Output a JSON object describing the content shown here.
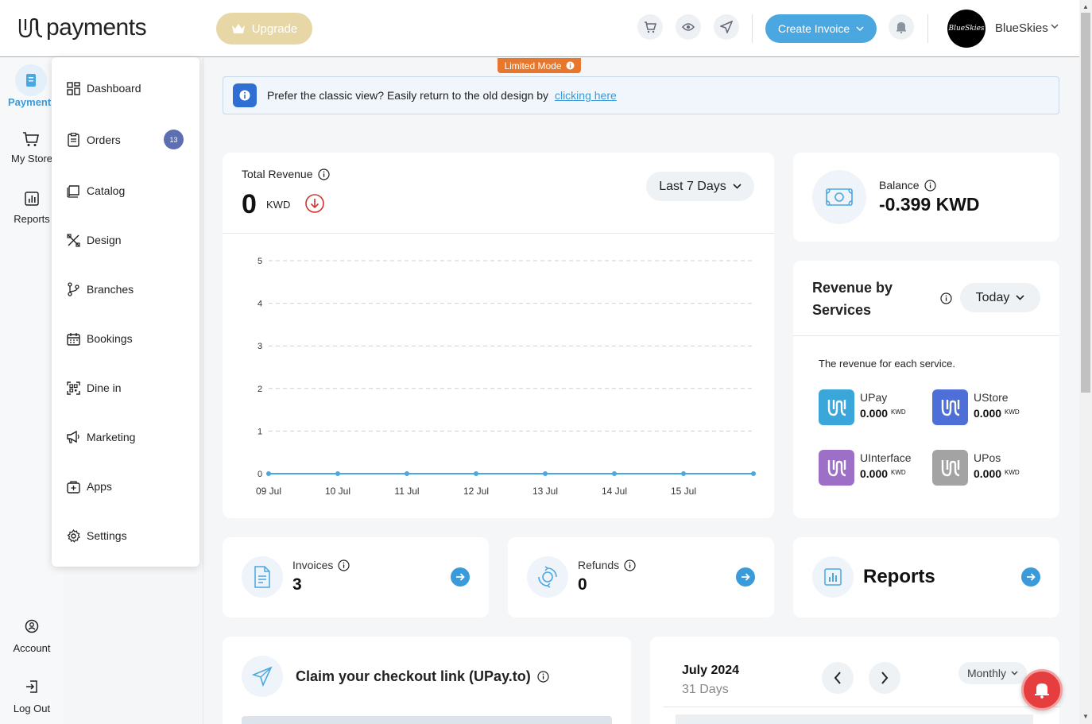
{
  "header": {
    "logo_text": "payments",
    "upgrade_label": "Upgrade",
    "create_invoice_label": "Create Invoice",
    "avatar_text": "BlueSkies",
    "username": "BlueSkies",
    "icons": [
      "cart-icon",
      "eye-icon",
      "send-icon",
      "bell-icon"
    ]
  },
  "rail": {
    "items": [
      {
        "label": "Payments",
        "icon": "payments-icon",
        "active": true
      },
      {
        "label": "My Store",
        "icon": "cart-icon"
      },
      {
        "label": "Reports",
        "icon": "chart-icon"
      },
      {
        "label": "Account",
        "icon": "account-icon"
      },
      {
        "label": "Log Out",
        "icon": "logout-icon"
      }
    ]
  },
  "menu": {
    "items": [
      {
        "label": "Dashboard",
        "icon": "dashboard-icon"
      },
      {
        "label": "Orders",
        "icon": "orders-icon",
        "badge": "13"
      },
      {
        "label": "Catalog",
        "icon": "catalog-icon"
      },
      {
        "label": "Design",
        "icon": "design-icon"
      },
      {
        "label": "Branches",
        "icon": "branches-icon"
      },
      {
        "label": "Bookings",
        "icon": "calendar-icon"
      },
      {
        "label": "Dine in",
        "icon": "qr-icon"
      },
      {
        "label": "Marketing",
        "icon": "megaphone-icon"
      },
      {
        "label": "Apps",
        "icon": "apps-icon"
      },
      {
        "label": "Settings",
        "icon": "gear-icon"
      }
    ]
  },
  "limited_mode": "Limited Mode",
  "banner": {
    "text": "Prefer the classic view? Easily return to the old design by",
    "link": "clicking here"
  },
  "revenue": {
    "title": "Total Revenue",
    "value": "0",
    "unit": "KWD",
    "period": "Last 7 Days"
  },
  "chart_data": {
    "type": "line",
    "categories": [
      "09 Jul",
      "10 Jul",
      "11 Jul",
      "12 Jul",
      "13 Jul",
      "14 Jul",
      "15 Jul",
      ""
    ],
    "series": [
      {
        "values": [
          0,
          0,
          0,
          0,
          0,
          0,
          0,
          0
        ],
        "color": "#4aa7e0"
      }
    ],
    "yticks": [
      "0",
      "1",
      "2",
      "3",
      "4",
      "5"
    ],
    "ylim": [
      0,
      5
    ],
    "grid": true
  },
  "balance": {
    "label": "Balance",
    "value": "-0.399 KWD"
  },
  "services": {
    "title": "Revenue by Services",
    "period": "Today",
    "description": "The revenue for each service.",
    "items": [
      {
        "name": "UPay",
        "amount": "0.000",
        "currency": "KWD",
        "color": "#3aa6da"
      },
      {
        "name": "UStore",
        "amount": "0.000",
        "currency": "KWD",
        "color": "#4f6fd8"
      },
      {
        "name": "UInterface",
        "amount": "0.000",
        "currency": "KWD",
        "color": "#9d6fc7"
      },
      {
        "name": "UPos",
        "amount": "0.000",
        "currency": "KWD",
        "color": "#a3a3a3"
      }
    ]
  },
  "invoices": {
    "label": "Invoices",
    "value": "3"
  },
  "refunds": {
    "label": "Refunds",
    "value": "0"
  },
  "reports": {
    "label": "Reports"
  },
  "claim": {
    "title": "Claim your checkout link (UPay.to)"
  },
  "calendar": {
    "month": "July 2024",
    "days": "31 Days",
    "mode": "Monthly"
  }
}
